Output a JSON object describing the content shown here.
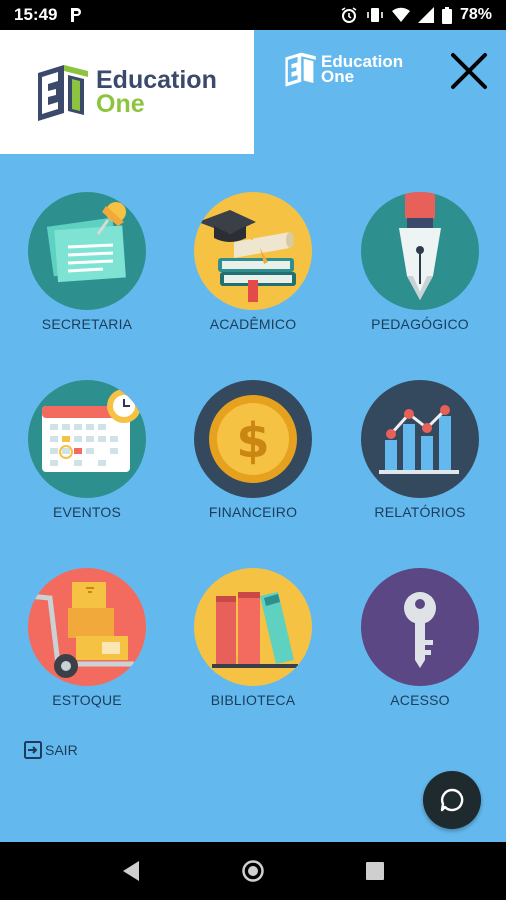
{
  "status_bar": {
    "time": "15:49",
    "battery": "78%",
    "icons": [
      "parking-app-icon",
      "alarm-icon",
      "vibrate-icon",
      "wifi-icon",
      "signal-icon",
      "battery-icon"
    ]
  },
  "header": {
    "logo_line1": "Education",
    "logo_line2": "One",
    "small_logo_line1": "Education",
    "small_logo_line2": "One",
    "close_icon": "close-icon"
  },
  "menu": {
    "items": [
      {
        "label": "SECRETARIA",
        "icon": "secretaria-icon",
        "bg": "#2e8f8f"
      },
      {
        "label": "ACADÊMICO",
        "icon": "academico-icon",
        "bg": "#f6c244"
      },
      {
        "label": "PEDAGÓGICO",
        "icon": "pedagogico-icon",
        "bg": "#2e8f8f"
      },
      {
        "label": "EVENTOS",
        "icon": "eventos-icon",
        "bg": "#2e8f8f"
      },
      {
        "label": "FINANCEIRO",
        "icon": "financeiro-icon",
        "bg": "#34495e"
      },
      {
        "label": "RELATÓRIOS",
        "icon": "relatorios-icon",
        "bg": "#34495e"
      },
      {
        "label": "ESTOQUE",
        "icon": "estoque-icon",
        "bg": "#f36b5e"
      },
      {
        "label": "BIBLIOTECA",
        "icon": "biblioteca-icon",
        "bg": "#f6c244"
      },
      {
        "label": "ACESSO",
        "icon": "acesso-icon",
        "bg": "#5a4783"
      }
    ]
  },
  "sair": {
    "label": "SAIR",
    "icon": "logout-icon"
  },
  "chat": {
    "icon": "chat-icon"
  },
  "nav": {
    "back": "back-icon",
    "home": "home-icon",
    "recents": "recents-icon"
  }
}
